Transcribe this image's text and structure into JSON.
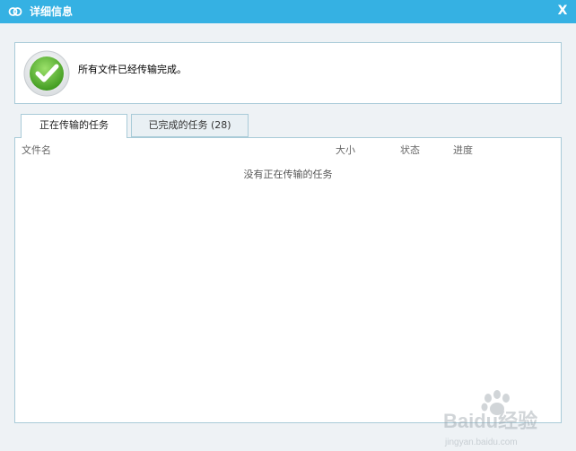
{
  "window": {
    "title": "详细信息",
    "close_glyph": "X"
  },
  "status": {
    "message": "所有文件已经传输完成。",
    "icon": "check-circle-icon"
  },
  "tabs": [
    {
      "label": "正在传输的任务",
      "active": true
    },
    {
      "label": "已完成的任务 (28)",
      "active": false
    }
  ],
  "table": {
    "columns": {
      "name": "文件名",
      "size": "大小",
      "state": "状态",
      "progress": "进度"
    },
    "empty_message": "没有正在传输的任务"
  },
  "watermark": {
    "brand": "Baidu经验",
    "url": "jingyan.baidu.com"
  },
  "colors": {
    "titlebar": "#35b1e3",
    "border": "#a9cbd8",
    "check_green": "#5cb531"
  }
}
